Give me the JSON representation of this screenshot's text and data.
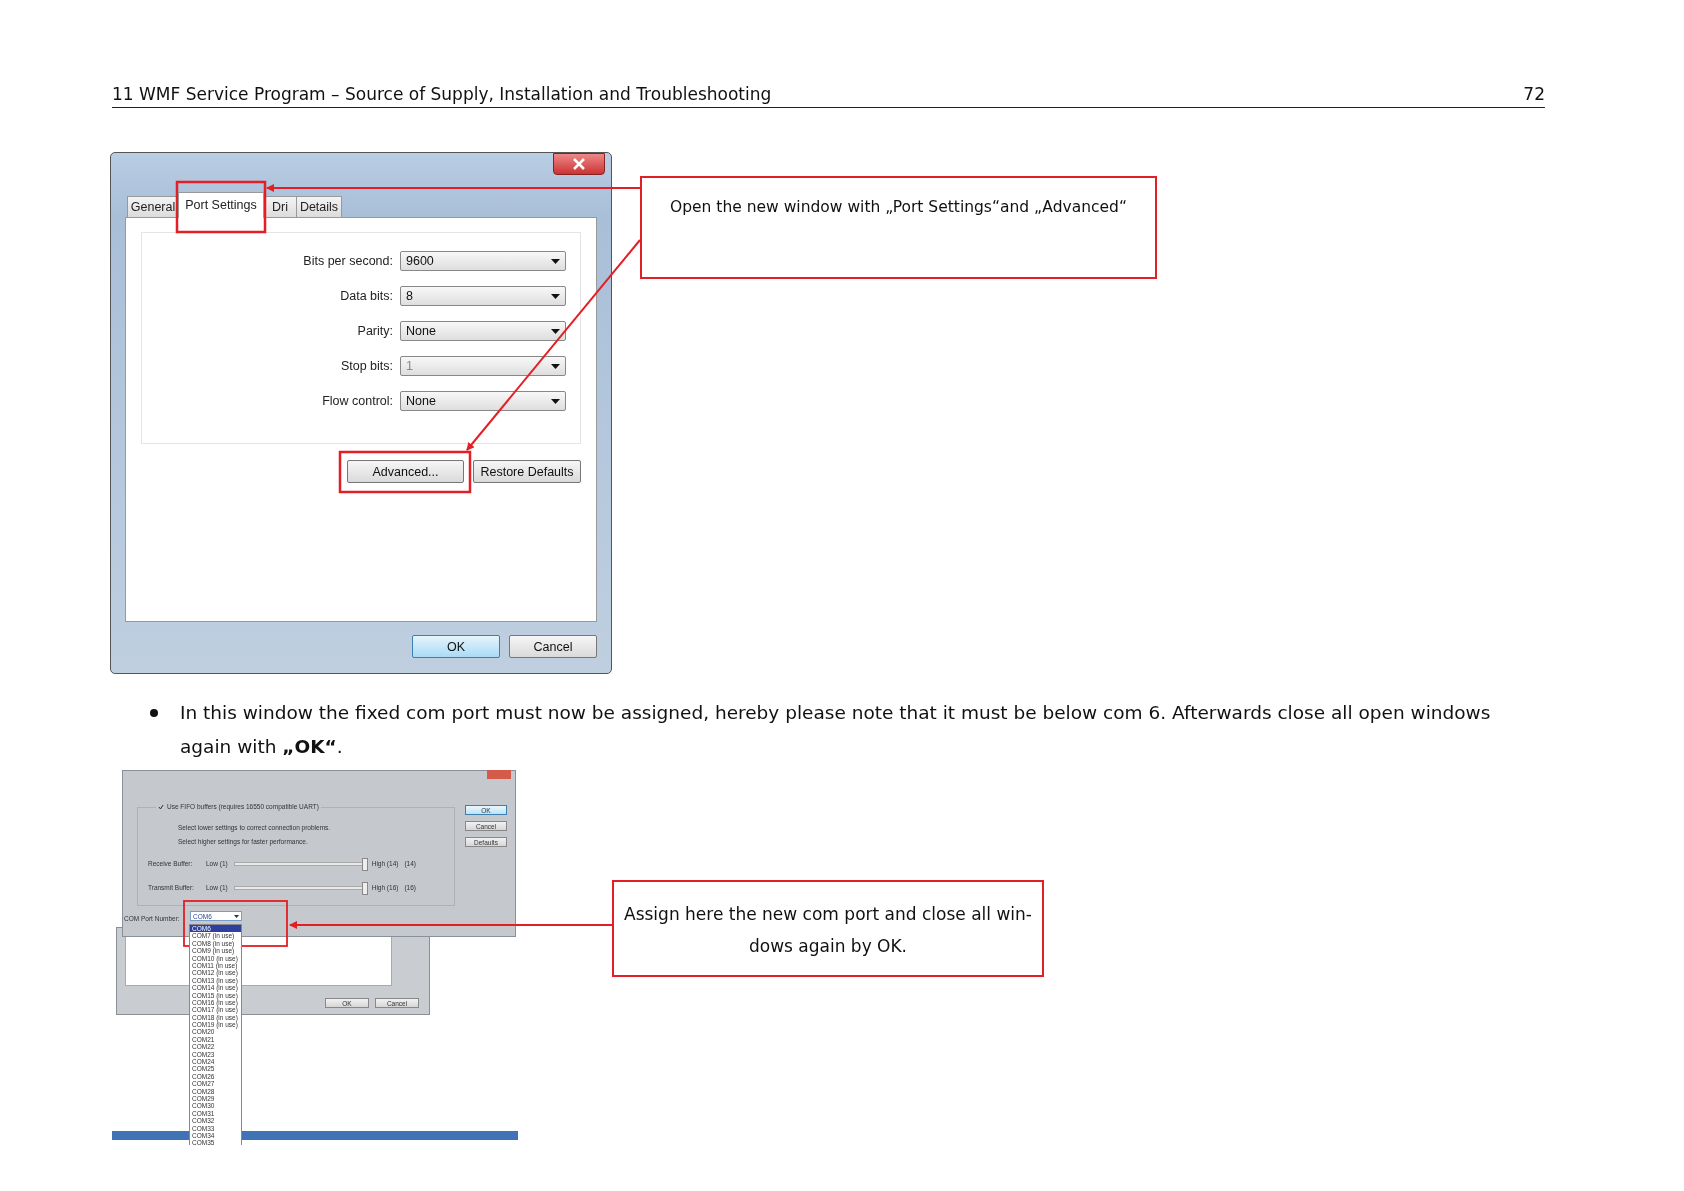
{
  "header": {
    "title": "11 WMF Service Program – Source of Supply, Installation and Troubleshooting",
    "page_number": "72"
  },
  "dialog1": {
    "tabs": [
      {
        "label": "General",
        "selected": false
      },
      {
        "label": "Port Settings",
        "selected": true
      },
      {
        "label": "Dri",
        "selected": false
      },
      {
        "label": "Details",
        "selected": false
      }
    ],
    "fields": [
      {
        "label": "Bits per second:",
        "value": "9600",
        "disabled": false
      },
      {
        "label": "Data bits:",
        "value": "8",
        "disabled": false
      },
      {
        "label": "Parity:",
        "value": "None",
        "disabled": false
      },
      {
        "label": "Stop bits:",
        "value": "1",
        "disabled": true
      },
      {
        "label": "Flow control:",
        "value": "None",
        "disabled": false
      }
    ],
    "buttons": [
      "Advanced...",
      "Restore Defaults"
    ],
    "footer_buttons": [
      {
        "label": "OK",
        "default": true
      },
      {
        "label": "Cancel",
        "default": false
      }
    ]
  },
  "callout1": "Open the new window with „Port Settings“and „Advanced“",
  "bullet": "In this window the fixed com port must now be assigned, hereby please note that it must be below com 6. Afterwards close all open windows again with **„OK“**.",
  "dialog2": {
    "fifo": {
      "label": "Use FIFO buffers (requires 16550 compatible UART)",
      "checked": true
    },
    "hints": [
      "Select lower settings to correct connection problems.",
      "Select higher settings for faster performance."
    ],
    "sliders": [
      {
        "label": "Receive Buffer:",
        "low": "Low (1)",
        "high": "High (14)",
        "reading": "(14)",
        "level": 1
      },
      {
        "label": "Transmit Buffer:",
        "low": "Low (1)",
        "high": "High (16)",
        "reading": "(16)",
        "level": 1
      }
    ],
    "buttons": [
      "OK",
      "Cancel",
      "Defaults"
    ],
    "port_label": "COM Port Number:",
    "port_value": "COM6",
    "port_list": [
      {
        "label": "COM6",
        "selected": true
      },
      {
        "label": "COM7 (in use)",
        "selected": false
      },
      {
        "label": "COM8 (in use)",
        "selected": false
      },
      {
        "label": "COM9 (in use)",
        "selected": false
      },
      {
        "label": "COM10 (in use)",
        "selected": false
      },
      {
        "label": "COM11 (in use)",
        "selected": false
      },
      {
        "label": "COM12 (in use)",
        "selected": false
      },
      {
        "label": "COM13 (in use)",
        "selected": false
      },
      {
        "label": "COM14 (in use)",
        "selected": false
      },
      {
        "label": "COM15 (in use)",
        "selected": false
      },
      {
        "label": "COM16 (in use)",
        "selected": false
      },
      {
        "label": "COM17 (in use)",
        "selected": false
      },
      {
        "label": "COM18 (in use)",
        "selected": false
      },
      {
        "label": "COM19 (in use)",
        "selected": false
      },
      {
        "label": "COM20",
        "selected": false
      },
      {
        "label": "COM21",
        "selected": false
      },
      {
        "label": "COM22",
        "selected": false
      },
      {
        "label": "COM23",
        "selected": false
      },
      {
        "label": "COM24",
        "selected": false
      },
      {
        "label": "COM25",
        "selected": false
      },
      {
        "label": "COM26",
        "selected": false
      },
      {
        "label": "COM27",
        "selected": false
      },
      {
        "label": "COM28",
        "selected": false
      },
      {
        "label": "COM29",
        "selected": false
      },
      {
        "label": "COM30",
        "selected": false
      },
      {
        "label": "COM31",
        "selected": false
      },
      {
        "label": "COM32",
        "selected": false
      },
      {
        "label": "COM33",
        "selected": false
      },
      {
        "label": "COM34",
        "selected": false
      },
      {
        "label": "COM35",
        "selected": false
      }
    ],
    "back_buttons": [
      "OK",
      "Cancel"
    ]
  },
  "callout2": [
    "Assign here the new com port and close all win-",
    "dows again by OK."
  ]
}
